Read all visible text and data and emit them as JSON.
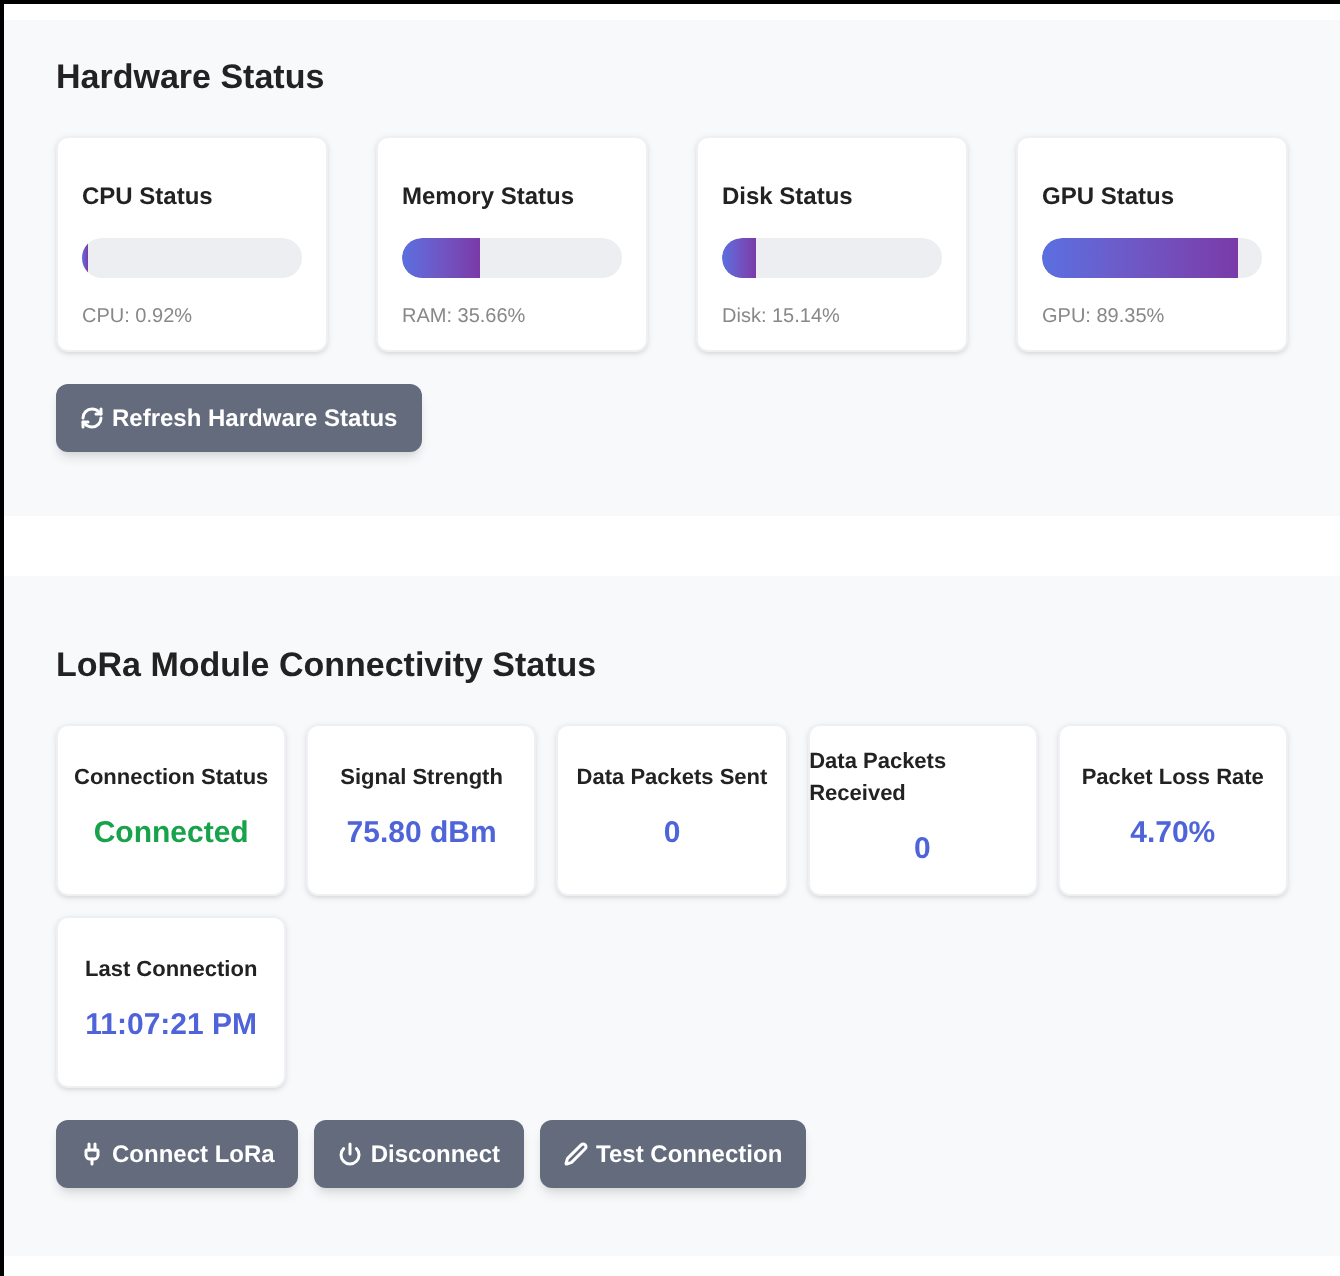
{
  "hardware": {
    "title": "Hardware Status",
    "metrics": [
      {
        "name": "CPU Status",
        "level": 0.0092,
        "reading": "CPU: 0.92%"
      },
      {
        "name": "Memory Status",
        "level": 0.3566,
        "reading": "RAM: 35.66%"
      },
      {
        "name": "Disk Status",
        "level": 0.1514,
        "reading": "Disk: 15.14%"
      },
      {
        "name": "GPU Status",
        "level": 0.8935,
        "reading": "GPU: 89.35%"
      }
    ],
    "button": {
      "kind": "refresh",
      "label": "Refresh Hardware Status"
    }
  },
  "lora": {
    "title": "LoRa Module Connectivity Status",
    "stats": [
      {
        "label": "Connection Status",
        "value": "Connected",
        "color": "#16a34a"
      },
      {
        "label": "Signal Strength",
        "value": "75.80 dBm",
        "color": "#4f64d8"
      },
      {
        "label": "Data Packets Sent",
        "value": "0",
        "color": "#4f64d8"
      },
      {
        "label": "Data Packets Received",
        "value": "0",
        "color": "#4f64d8"
      },
      {
        "label": "Packet Loss Rate",
        "value": "4.70%",
        "color": "#4f64d8"
      },
      {
        "label": "Last Connection",
        "value": "11:07:21 PM",
        "color": "#4f64d8"
      }
    ],
    "buttons": [
      {
        "kind": "plug",
        "label": "Connect LoRa"
      },
      {
        "kind": "power",
        "label": "Disconnect"
      },
      {
        "kind": "wand",
        "label": "Test Connection"
      }
    ]
  }
}
